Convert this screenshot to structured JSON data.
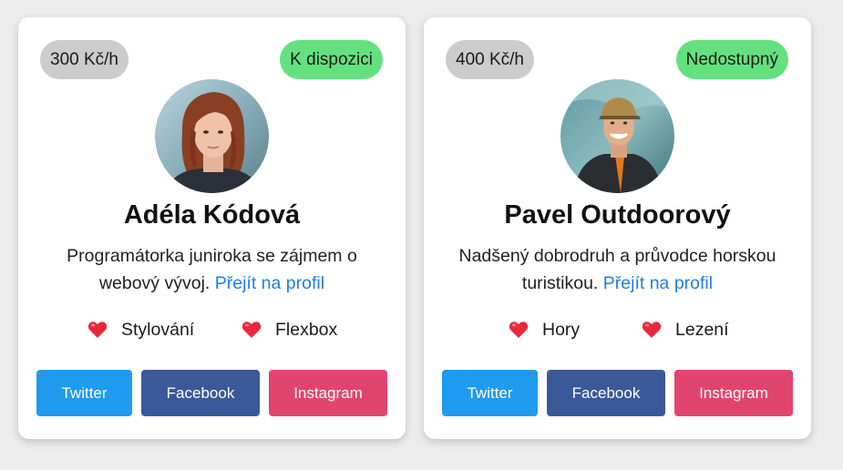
{
  "colors": {
    "page_bg": "#ececec",
    "card_bg": "#ffffff",
    "price_badge_bg": "#cccccc",
    "available": "#64e17f",
    "unavailable": "#64e17f",
    "link": "#1e7fe0",
    "twitter": "#1f9bef",
    "facebook": "#3b5998",
    "instagram": "#e1456f",
    "heart": "#e8283a"
  },
  "cards": [
    {
      "price": "300 Kč/h",
      "status": "K dispozici",
      "name": "Adéla Kódová",
      "bio_text": "Programátorka juniroka se zájmem o webový vývoj.",
      "profile_link": "Přejít na profil",
      "interests": [
        "Stylování",
        "Flexbox"
      ],
      "avatar_icon": "woman-portrait-photo",
      "socials": {
        "twitter": "Twitter",
        "facebook": "Facebook",
        "instagram": "Instagram"
      }
    },
    {
      "price": "400 Kč/h",
      "status": "Nedostupný",
      "name": "Pavel Outdoorový",
      "bio_text": "Nadšený dobrodruh a průvodce horskou turistikou.",
      "profile_link": "Přejít na profil",
      "interests": [
        "Hory",
        "Lezení"
      ],
      "avatar_icon": "man-portrait-photo",
      "socials": {
        "twitter": "Twitter",
        "facebook": "Facebook",
        "instagram": "Instagram"
      }
    }
  ]
}
